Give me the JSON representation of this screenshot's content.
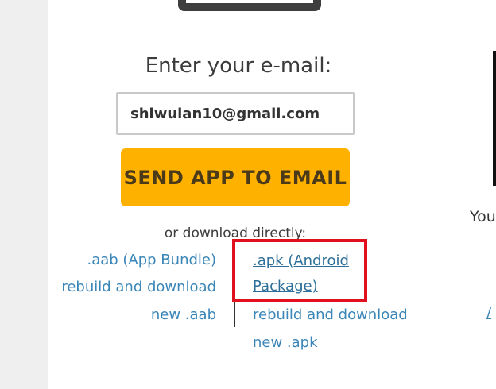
{
  "form": {
    "heading": "Enter your e-mail:",
    "email_value": "shiwulan10@gmail.com",
    "send_button": "SEND APP TO EMAIL",
    "or_text": "or download directly:"
  },
  "downloads": {
    "aab_link": ".aab (App Bundle)",
    "aab_rebuild_line1": "rebuild and download",
    "aab_rebuild_line2": "new .aab",
    "apk_link_line1": ".apk (Android",
    "apk_link_line2": "Package)",
    "apk_rebuild_line1": "rebuild and download",
    "apk_rebuild_line2": "new .apk"
  },
  "right_panel": {
    "text": "You",
    "link": "/"
  },
  "colors": {
    "accent_button": "#ffb100",
    "link": "#3a86b8",
    "highlight": "#e0101f"
  },
  "icons": [
    "envelope-icon"
  ]
}
